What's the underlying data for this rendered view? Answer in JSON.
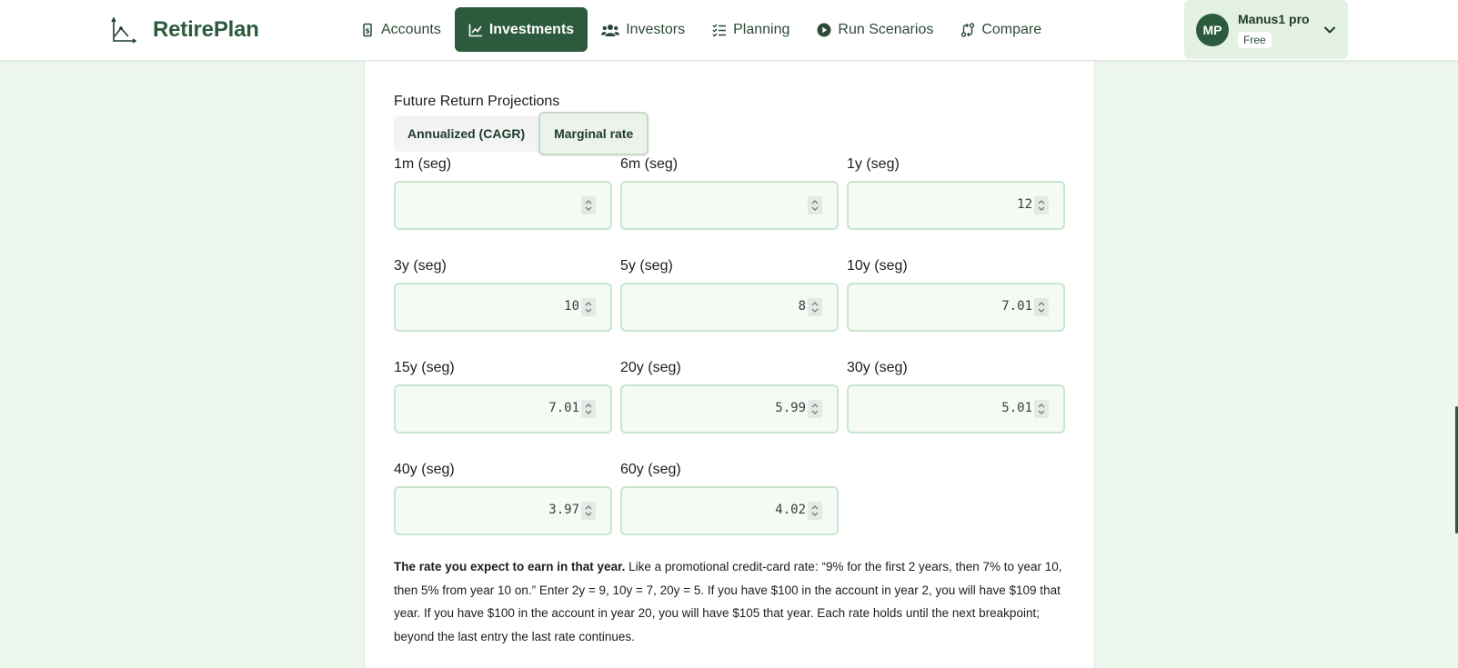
{
  "app": {
    "name": "RetirePlan"
  },
  "nav": [
    {
      "label": "Accounts",
      "icon": "dollar-note-icon",
      "active": false
    },
    {
      "label": "Investments",
      "icon": "line-chart-icon",
      "active": true
    },
    {
      "label": "Investors",
      "icon": "users-icon",
      "active": false
    },
    {
      "label": "Planning",
      "icon": "checklist-icon",
      "active": false
    },
    {
      "label": "Run Scenarios",
      "icon": "play-circle-icon",
      "active": false
    },
    {
      "label": "Compare",
      "icon": "compare-arrows-icon",
      "active": false
    }
  ],
  "user": {
    "initials": "MP",
    "name": "Manus1 pro",
    "plan": "Free"
  },
  "section": {
    "title": "Future Return Projections",
    "modes": [
      "Annualized (CAGR)",
      "Marginal rate"
    ],
    "selected_mode": "Marginal rate"
  },
  "fields": [
    {
      "label": "1m (seg)",
      "value": ""
    },
    {
      "label": "6m (seg)",
      "value": ""
    },
    {
      "label": "1y (seg)",
      "value": "12"
    },
    {
      "label": "3y (seg)",
      "value": "10"
    },
    {
      "label": "5y (seg)",
      "value": "8"
    },
    {
      "label": "10y (seg)",
      "value": "7.01"
    },
    {
      "label": "15y (seg)",
      "value": "7.01"
    },
    {
      "label": "20y (seg)",
      "value": "5.99"
    },
    {
      "label": "30y (seg)",
      "value": "5.01"
    },
    {
      "label": "40y (seg)",
      "value": "3.97"
    },
    {
      "label": "60y (seg)",
      "value": "4.02"
    }
  ],
  "help": {
    "lead": "The rate you expect to earn in that year.",
    "body": " Like a promotional credit-card rate: “9% for the first 2 years, then 7% to year 10, then 5% from year 10 on.” Enter 2y = 9, 10y = 7, 20y = 5. If you have $100 in the account in year 2, you will have $109 that year. If you have $100 in the account in year 20, you will have $105 that year. Each rate holds until the next breakpoint; beyond the last entry the last rate continues."
  },
  "colors": {
    "brand": "#2c5a3c",
    "page_bg": "#eef7ee",
    "input_border": "#c7e6cf"
  }
}
